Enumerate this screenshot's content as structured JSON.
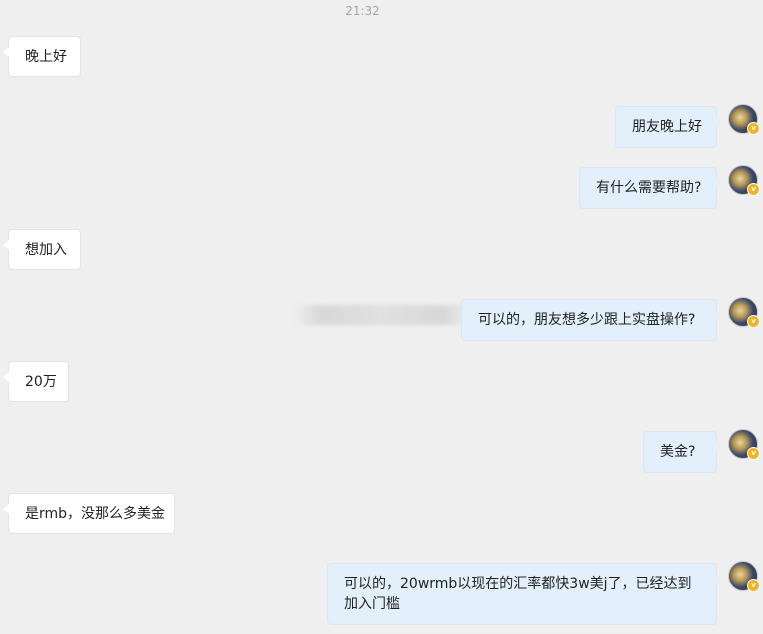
{
  "conversation": {
    "timestamp": "21:32",
    "messages": [
      {
        "side": "left",
        "text": "晚上好"
      },
      {
        "side": "right",
        "text": "朋友晚上好"
      },
      {
        "side": "right",
        "text": "有什么需要帮助?"
      },
      {
        "side": "left",
        "text": "想加入"
      },
      {
        "side": "right",
        "text": "可以的，朋友想多少跟上实盘操作?"
      },
      {
        "side": "left",
        "text": "20万"
      },
      {
        "side": "right",
        "text": "美金?"
      },
      {
        "side": "left",
        "text": "是rmb，没那么多美金"
      },
      {
        "side": "right",
        "text": "可以的，20wrmb以现在的汇率都快3w美j了，已经达到加入门槛"
      }
    ]
  },
  "avatar": {
    "badge_glyph": "v",
    "badge_color": "#f2b422"
  },
  "colors": {
    "background": "#efefef",
    "left_bubble": "#ffffff",
    "right_bubble": "#e3effb"
  }
}
